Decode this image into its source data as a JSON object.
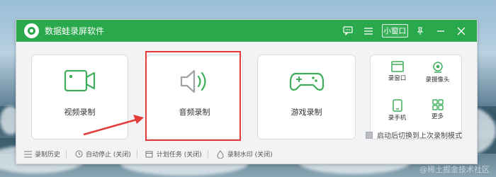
{
  "window": {
    "title": "数据蛙录屏软件",
    "mini_window_label": "小窗口"
  },
  "cards": {
    "video_label": "视频录制",
    "audio_label": "音频录制",
    "game_label": "游戏录制"
  },
  "more_grid": {
    "record_window": "录窗口",
    "record_camera": "录摄像头",
    "record_phone": "录手机",
    "more": "更多"
  },
  "option": {
    "restore_last_mode": "启动后切换到上次录制模式"
  },
  "bottombar": {
    "history": "录制历史",
    "auto_stop": "自动停止 (关闭)",
    "scheduled_task": "计划任务 (关闭)",
    "watermark": "录制水印 (关闭)"
  },
  "image_watermark": "@稀土掘金技术社区",
  "colors": {
    "brand_green": "#29a94c",
    "highlight_red": "#e53a3a",
    "icon_green": "#3fae5a"
  },
  "icons": {
    "video": "video-camera-icon",
    "audio": "speaker-icon",
    "game": "gamepad-icon",
    "window": "window-icon",
    "camera": "webcam-icon",
    "phone": "phone-icon",
    "more": "grid-icon"
  }
}
